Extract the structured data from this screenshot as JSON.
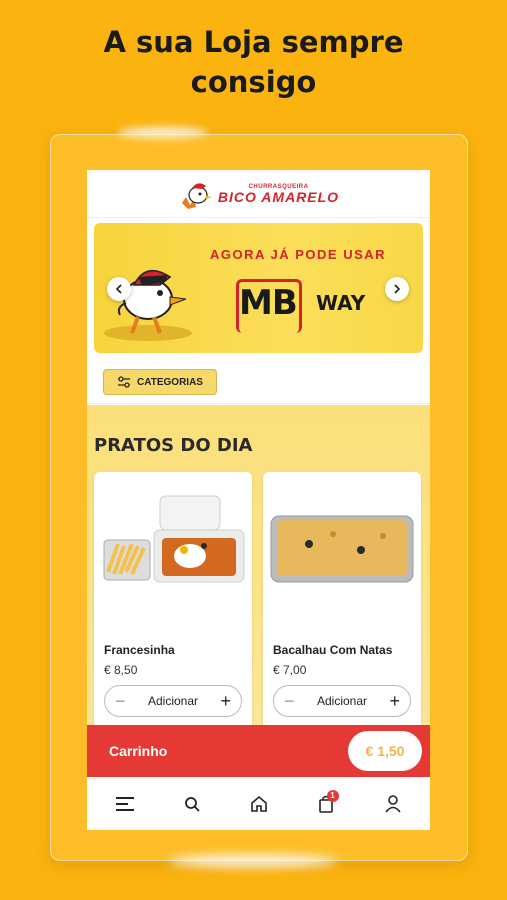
{
  "promo": {
    "headline_line1": "A sua Loja sempre",
    "headline_line2": "consigo"
  },
  "header": {
    "logo_small": "CHURRASQUEIRA",
    "logo_big": "BICO AMARELO"
  },
  "banner": {
    "title": "AGORA JÁ PODE USAR",
    "mb_text": "MB",
    "way_text": "WAY"
  },
  "categories": {
    "label": "CATEGORIAS"
  },
  "section": {
    "title": "PRATOS DO DIA"
  },
  "products": [
    {
      "name": "Francesinha",
      "price": "€ 8,50",
      "add_label": "Adicionar"
    },
    {
      "name": "Bacalhau Com Natas",
      "price": "€ 7,00",
      "add_label": "Adicionar"
    }
  ],
  "cart": {
    "label": "Carrinho",
    "total": "€ 1,50",
    "badge": "1"
  },
  "nav": {
    "items": [
      "menu-icon",
      "search-icon",
      "home-icon",
      "cart-icon",
      "user-icon"
    ]
  },
  "colors": {
    "background": "#fbb30f",
    "brand_red": "#e53935",
    "banner_yellow": "#f7d33c"
  }
}
